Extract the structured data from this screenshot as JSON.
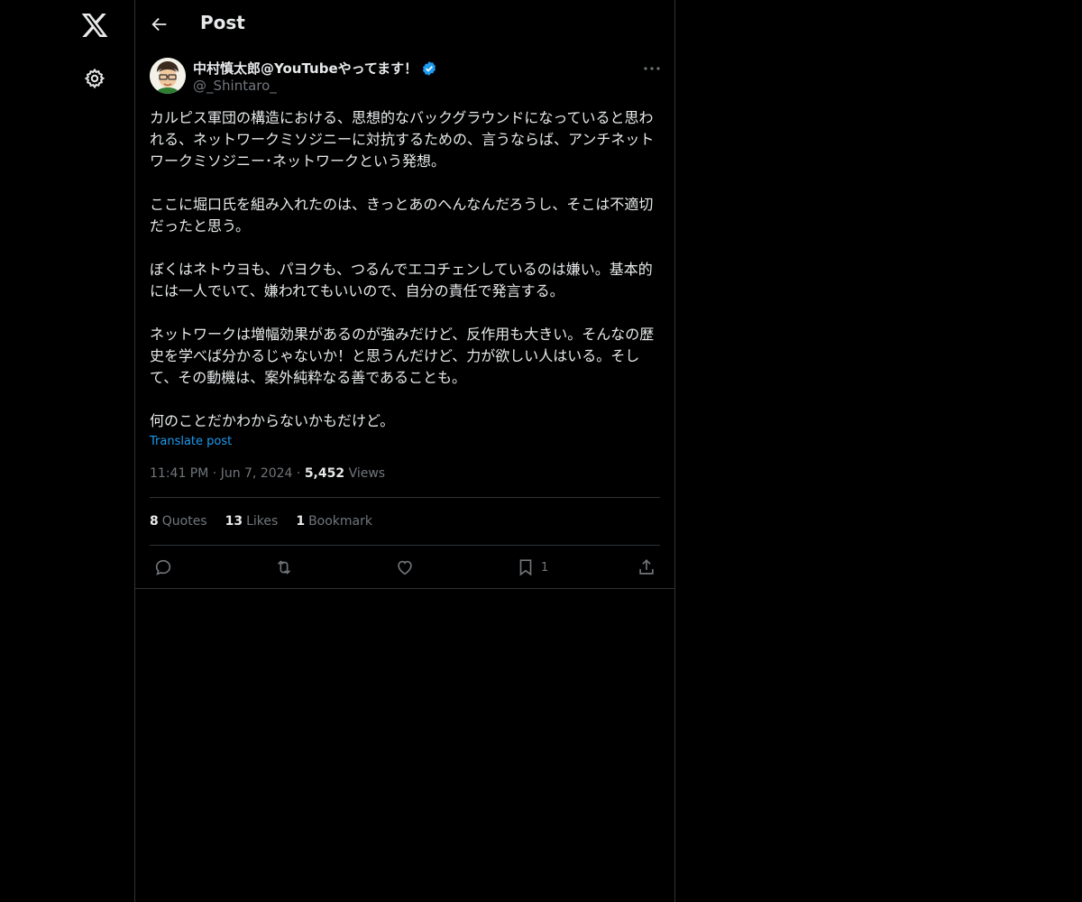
{
  "app": {
    "logo_icon": "x-logo-icon",
    "settings_icon": "gear-icon"
  },
  "header": {
    "title": "Post"
  },
  "post": {
    "author_name": "中村慎太郎@YouTubeやってます！",
    "handle": "@_Shintaro_",
    "text": "カルピス軍団の構造における、思想的なバックグラウンドになっていると思われる、ネットワークミソジニーに対抗するための、言うならば、アンチネットワークミソジニー･ネットワークという発想。\n\nここに堀口氏を組み入れたのは、きっとあのへんなんだろうし、そこは不適切だったと思う。\n\nぼくはネトウヨも、パヨクも、つるんでエコチェンしているのは嫌い。基本的には一人でいて、嫌われてもいいので、自分の責任で発言する。\n\nネットワークは増幅効果があるのが強みだけど、反作用も大きい。そんなの歴史を学べば分かるじゃないか！と思うんだけど、力が欲しい人はいる。そして、その動機は、案外純粋なる善であることも。\n\n何のことだかわからないかもだけど。",
    "translate_label": "Translate post",
    "time": "11:41 PM",
    "date": "Jun 7, 2024",
    "views_count": "5,452",
    "views_label": "Views",
    "quotes_count": "8",
    "quotes_label": "Quotes",
    "likes_count": "13",
    "likes_label": "Likes",
    "bookmarks_count": "1",
    "bookmarks_label": "Bookmark",
    "bookmark_action_count": "1"
  },
  "colors": {
    "accent": "#1d9bf0",
    "muted": "#71767b",
    "text": "#e7e9ea",
    "border": "#2f3336",
    "background": "#000000"
  }
}
